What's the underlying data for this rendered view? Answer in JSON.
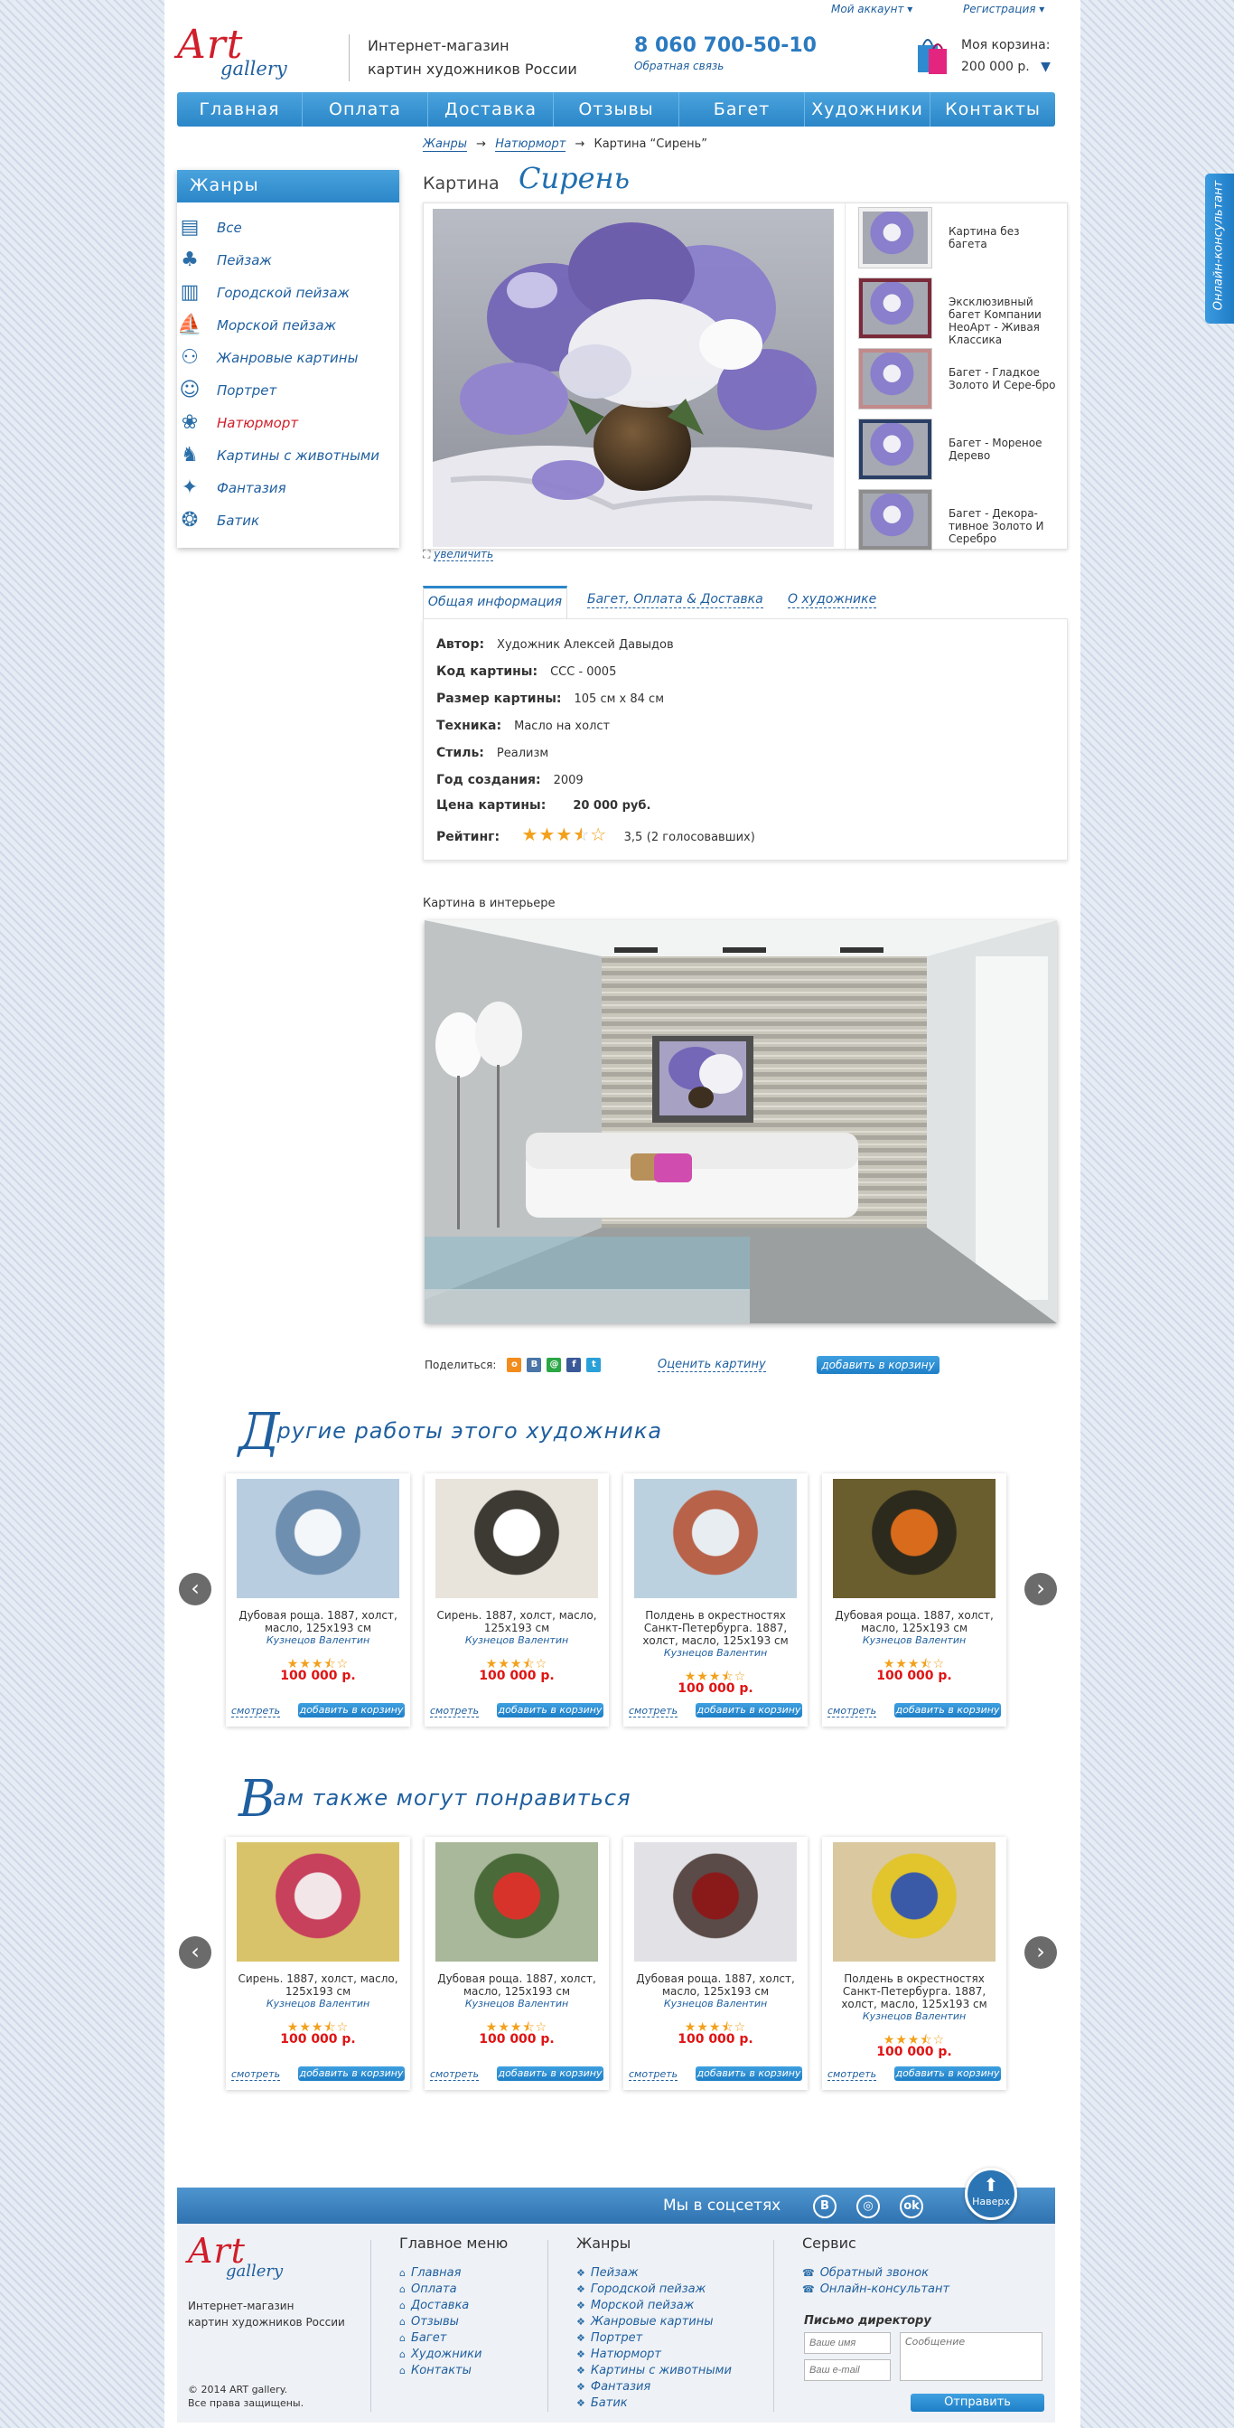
{
  "header": {
    "my_account": "Мой аккаунт",
    "register": "Регистрация",
    "logo_art": "Art",
    "logo_gallery": "gallery",
    "tagline1": "Интернет-магазин",
    "tagline2": "картин художников России",
    "phone": "8 060 700-50-10",
    "callback": "Обратная связь",
    "cart_label": "Моя корзина:",
    "cart_sum": "200 000 р."
  },
  "nav": [
    "Главная",
    "Оплата",
    "Доставка",
    "Отзывы",
    "Багет",
    "Художники",
    "Контакты"
  ],
  "sidebar": {
    "title": "Жанры",
    "items": [
      {
        "label": "Все",
        "icon": "books-icon"
      },
      {
        "label": "Пейзаж",
        "icon": "tree-icon"
      },
      {
        "label": "Городской пейзаж",
        "icon": "city-icon"
      },
      {
        "label": "Морской пейзаж",
        "icon": "sailboat-icon"
      },
      {
        "label": "Жанровые картины",
        "icon": "figures-icon"
      },
      {
        "label": "Портрет",
        "icon": "portrait-icon"
      },
      {
        "label": "Натюрморт",
        "icon": "still-life-icon",
        "active": true
      },
      {
        "label": "Картины с животными",
        "icon": "horse-icon"
      },
      {
        "label": "Фантазия",
        "icon": "fantasy-icon"
      },
      {
        "label": "Батик",
        "icon": "batik-icon"
      }
    ]
  },
  "breadcrumb": {
    "c1": "Жанры",
    "c2": "Натюрморт",
    "c3": "Картина “Сирень”",
    "sep": "→"
  },
  "title": {
    "prefix": "Картина",
    "name": "Сирень"
  },
  "frames": [
    {
      "label": "Картина без багета",
      "color": "#f0f0f0"
    },
    {
      "label": "Эксклюзивный багет Компании НеоАрт - Живая Классика",
      "color": "#7a2a3a"
    },
    {
      "label": "Багет - Гладкое Золото И Сере-бро",
      "color": "#c28a8a"
    },
    {
      "label": "Багет - Мореное Дерево",
      "color": "#2a3f66"
    },
    {
      "label": "Багет - Декора-тивное Золото И Серебро",
      "color": "#8d8d8d"
    }
  ],
  "zoom": "увеличить",
  "tabs": [
    "Общая информация",
    "Багет, Оплата & Доставка",
    "О художнике"
  ],
  "details": {
    "author_k": "Автор:",
    "author_v": "Художник Алексей Давыдов",
    "code_k": "Код картины:",
    "code_v": "CCC - 0005",
    "size_k": "Размер картины:",
    "size_v": "105 см х 84 см",
    "tech_k": "Техника:",
    "tech_v": "Масло на холст",
    "style_k": "Стиль:",
    "style_v": "Реализм",
    "year_k": "Год создания:",
    "year_v": "2009",
    "price_k": "Цена картины:",
    "price_v": "20 000 руб.",
    "rating_k": "Рейтинг:",
    "rating_v": "3,5",
    "votes": "(2 голосовавших)",
    "rating": 3.5
  },
  "interior_label": "Картина  в интерьере",
  "share": {
    "label": "Поделиться:",
    "rate": "Оценить картину",
    "add": "добавить в корзину",
    "icons": [
      {
        "t": "o",
        "c": "#f28c1c"
      },
      {
        "t": "B",
        "c": "#4a76a8"
      },
      {
        "t": "@",
        "c": "#2ba745"
      },
      {
        "t": "f",
        "c": "#3b5998"
      },
      {
        "t": "t",
        "c": "#2aa0d8"
      }
    ]
  },
  "sect1": {
    "big": "Д",
    "rest": "ругие работы этого художника"
  },
  "sect2": {
    "big": "В",
    "rest": "ам также могут понравиться"
  },
  "cards1": [
    {
      "cap": "Дубовая роща. 1887, холст, масло, 125х193 см",
      "au": "Кузнецов Валентин",
      "pr": "100 000 р.",
      "colors": [
        "#b9cde0",
        "#f4f7fa",
        "#6f8fb0"
      ]
    },
    {
      "cap": "Сирень. 1887, холст, масло, 125х193 см",
      "au": "Кузнецов Валентин",
      "pr": "100 000 р.",
      "colors": [
        "#e8e4dc",
        "#ffffff",
        "#3d3a34"
      ]
    },
    {
      "cap": "Полдень в окрестностях Санкт-Петербурга. 1887, холст, масло, 125х193 см",
      "au": "Кузнецов Валентин",
      "pr": "100 000 р.",
      "colors": [
        "#bcd1df",
        "#e8edf1",
        "#b8624a"
      ]
    },
    {
      "cap": "Дубовая роща. 1887, холст, масло, 125х193 см",
      "au": "Кузнецов Валентин",
      "pr": "100 000 р.",
      "colors": [
        "#6a5e2e",
        "#d86b1c",
        "#2c2a1c"
      ]
    }
  ],
  "cards2": [
    {
      "cap": "Сирень. 1887, холст, масло, 125х193 см",
      "au": "Кузнецов Валентин",
      "pr": "100 000 р.",
      "colors": [
        "#d9c36a",
        "#f2e6e9",
        "#c7405c"
      ]
    },
    {
      "cap": "Дубовая роща. 1887, холст, масло, 125х193 см",
      "au": "Кузнецов Валентин",
      "pr": "100 000 р.",
      "colors": [
        "#a9b79a",
        "#d8332a",
        "#4a6a3a"
      ]
    },
    {
      "cap": "Дубовая роща. 1887, холст, масло, 125х193 см",
      "au": "Кузнецов Валентин",
      "pr": "100 000 р.",
      "colors": [
        "#e2e2e6",
        "#8a1a1a",
        "#5a4a48"
      ]
    },
    {
      "cap": "Полдень в окрестностях Санкт-Петербурга. 1887, холст, масло, 125х193 см",
      "au": "Кузнецов Валентин",
      "pr": "100 000 р.",
      "colors": [
        "#d9c8a0",
        "#3a5aa8",
        "#e2c42c"
      ]
    }
  ],
  "card_see": "смотреть",
  "card_add": "добавить в корзину",
  "footer": {
    "social": "Мы в соцсетях",
    "top": "Наверх",
    "tag1": "Интернет-магазин",
    "tag2": "картин художников России",
    "copy1": "© 2014 ART gallery.",
    "copy2": "Все права защищены.",
    "menu_h": "Главное меню",
    "menu": [
      "Главная",
      "Оплата",
      "Доставка",
      "Отзывы",
      "Багет",
      "Художники",
      "Контакты"
    ],
    "genres_h": "Жанры",
    "genres": [
      "Пейзаж",
      "Городской пейзаж",
      "Морской пейзаж",
      "Жанровые картины",
      "Портрет",
      "Натюрморт",
      "Картины с животными",
      "Фантазия",
      "Батик"
    ],
    "service_h": "Сервис",
    "service": [
      "Обратный звонок",
      "Онлайн-консультант"
    ],
    "director_h": "Письмо директору",
    "name_ph": "Ваше имя",
    "email_ph": "Ваш e-mail",
    "msg_ph": "Сообщение",
    "send": "Отправить"
  },
  "consult": "Онлайн-консультант"
}
